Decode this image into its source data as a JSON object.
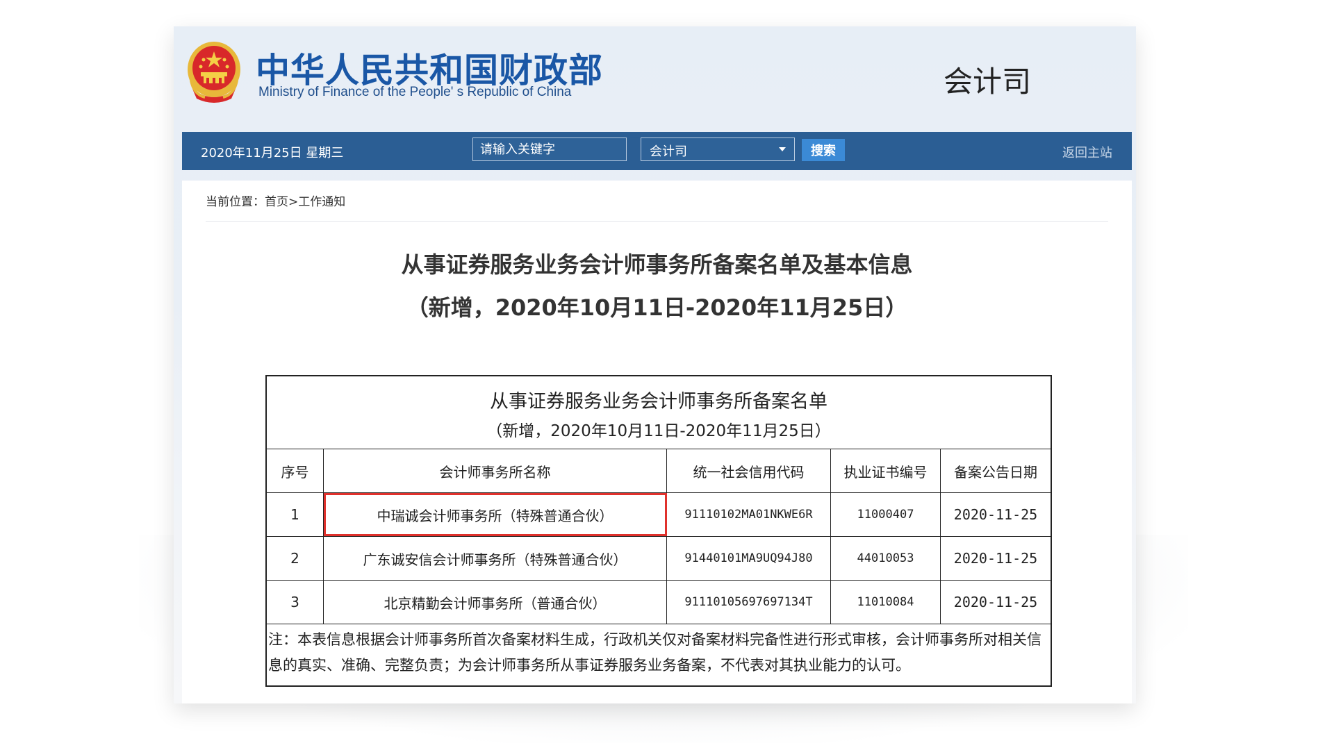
{
  "header": {
    "title_cn": "中华人民共和国财政部",
    "title_en": "Ministry of Finance of the People' s Republic of China",
    "department": "会计司"
  },
  "navbar": {
    "date": "2020年11月25日  星期三",
    "search_placeholder": "请输入关键字",
    "selected_scope": "会计司",
    "search_button": "搜索",
    "home_link": "返回主站"
  },
  "breadcrumb": "当前位置：首页>工作通知",
  "article": {
    "title": "从事证券服务业务会计师事务所备案名单及基本信息",
    "subtitle": "（新增，2020年10月11日-2020年11月25日）"
  },
  "table": {
    "caption_title": "从事证券服务业务会计师事务所备案名单",
    "caption_sub": "（新增，2020年10月11日-2020年11月25日）",
    "columns": [
      "序号",
      "会计师事务所名称",
      "统一社会信用代码",
      "执业证书编号",
      "备案公告日期"
    ],
    "rows": [
      [
        "1",
        "中瑞诚会计师事务所（特殊普通合伙）",
        "91110102MA01NKWE6R",
        "11000407",
        "2020-11-25"
      ],
      [
        "2",
        "广东诚安信会计师事务所（特殊普通合伙）",
        "91440101MA9UQ94J80",
        "44010053",
        "2020-11-25"
      ],
      [
        "3",
        "北京精勤会计师事务所（普通合伙）",
        "91110105697697134T",
        "11010084",
        "2020-11-25"
      ]
    ],
    "note": "注：本表信息根据会计师事务所首次备案材料生成，行政机关仅对备案材料完备性进行形式审核，会计师事务所对相关信息的真实、准确、完整负责；为会计师事务所从事证券服务业务备案，不代表对其执业能力的认可。"
  },
  "colors": {
    "nav_bg": "#2b5e94",
    "title_blue": "#1a57a6",
    "highlight_red": "#e0312c",
    "search_btn": "#3b8ad6"
  }
}
